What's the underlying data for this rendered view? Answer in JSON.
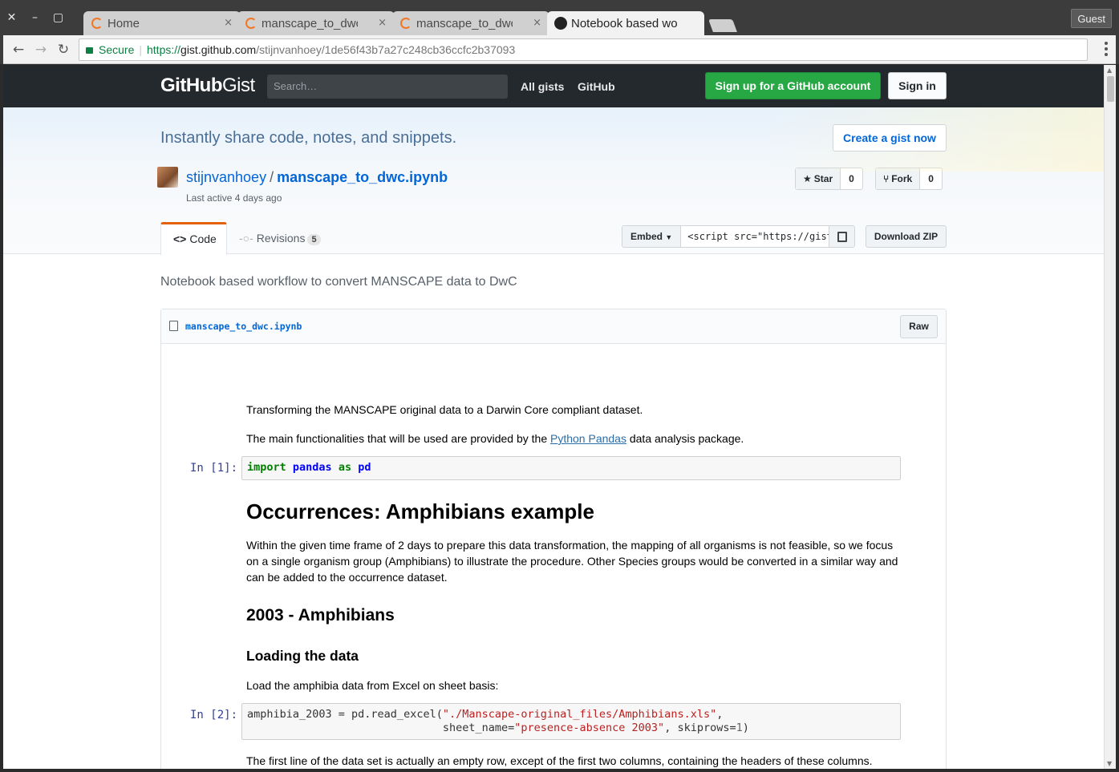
{
  "browser": {
    "window_buttons": {
      "close": "✕",
      "minimize": "–",
      "maximize": "▢"
    },
    "tabs": [
      {
        "title": "Home",
        "close": "×"
      },
      {
        "title": "manscape_to_dwc",
        "close": "×"
      },
      {
        "title": "manscape_to_dwc",
        "close": "×"
      },
      {
        "title": "Notebook based wo",
        "close": "×"
      }
    ],
    "guest_label": "Guest",
    "nav": {
      "back": "←",
      "forward": "→",
      "reload": "↻"
    },
    "secure_label": "Secure",
    "url": {
      "scheme": "https://",
      "host": "gist.github.com",
      "path": "/stijnvanhoey/1de56f43b7a27c248cb36ccfc2b37093"
    }
  },
  "header": {
    "logo_bold": "GitHub",
    "logo_light": "Gist",
    "search_placeholder": "Search…",
    "links": {
      "all_gists": "All gists",
      "github": "GitHub"
    },
    "signup": "Sign up for a GitHub account",
    "signin": "Sign in"
  },
  "banner": {
    "tagline": "Instantly share code, notes, and snippets.",
    "create_button": "Create a gist now"
  },
  "gist": {
    "owner": "stijnvanhoey",
    "separator": "/",
    "name": "manscape_to_dwc.ipynb",
    "last_active": "Last active 4 days ago",
    "star_label": "Star",
    "star_count": "0",
    "fork_label": "Fork",
    "fork_count": "0",
    "tab_code": "Code",
    "tab_revisions": "Revisions",
    "revisions_count": "5",
    "embed_label": "Embed",
    "embed_value": "<script src=\"https://gist",
    "download_zip": "Download ZIP",
    "description": "Notebook based workflow to convert MANSCAPE data to DwC"
  },
  "file": {
    "name": "manscape_to_dwc.ipynb",
    "raw_button": "Raw"
  },
  "notebook": {
    "intro_1": "Transforming the MANSCAPE original data to a Darwin Core compliant dataset.",
    "intro_2_pre": "The main functionalities that will be used are provided by the ",
    "intro_2_link": "Python Pandas",
    "intro_2_post": " data analysis package.",
    "prompt_1": "In [1]:",
    "code_1": {
      "kw_import": "import",
      "module": "pandas",
      "kw_as": "as",
      "alias": "pd"
    },
    "h1": "Occurrences: Amphibians example",
    "para_scope": "Within the given time frame of 2 days to prepare this data transformation, the mapping of all organisms is not feasible, so we focus on a single organism group (Amphibians) to illustrate the procedure. Other Species groups would be converted in a similar way and can be added to the occurrence dataset.",
    "h2": "2003 - Amphibians",
    "h3": "Loading the data",
    "para_load": "Load the amphibia data from Excel on sheet basis:",
    "prompt_2": "In [2]:",
    "code_2": {
      "line1_pre": "amphibia_2003 = pd.read_excel(",
      "line1_str": "\"./Manscape-original_files/Amphibians.xls\"",
      "line1_post": ",",
      "line2_indent": "                              sheet_name=",
      "line2_str": "\"presence-absence 2003\"",
      "line2_mid": ", skiprows=",
      "line2_num": "1",
      "line2_end": ")"
    },
    "para_first_line": "The first line of the data set is actually an empty row, except of the first two columns, containing the headers of these columns."
  }
}
